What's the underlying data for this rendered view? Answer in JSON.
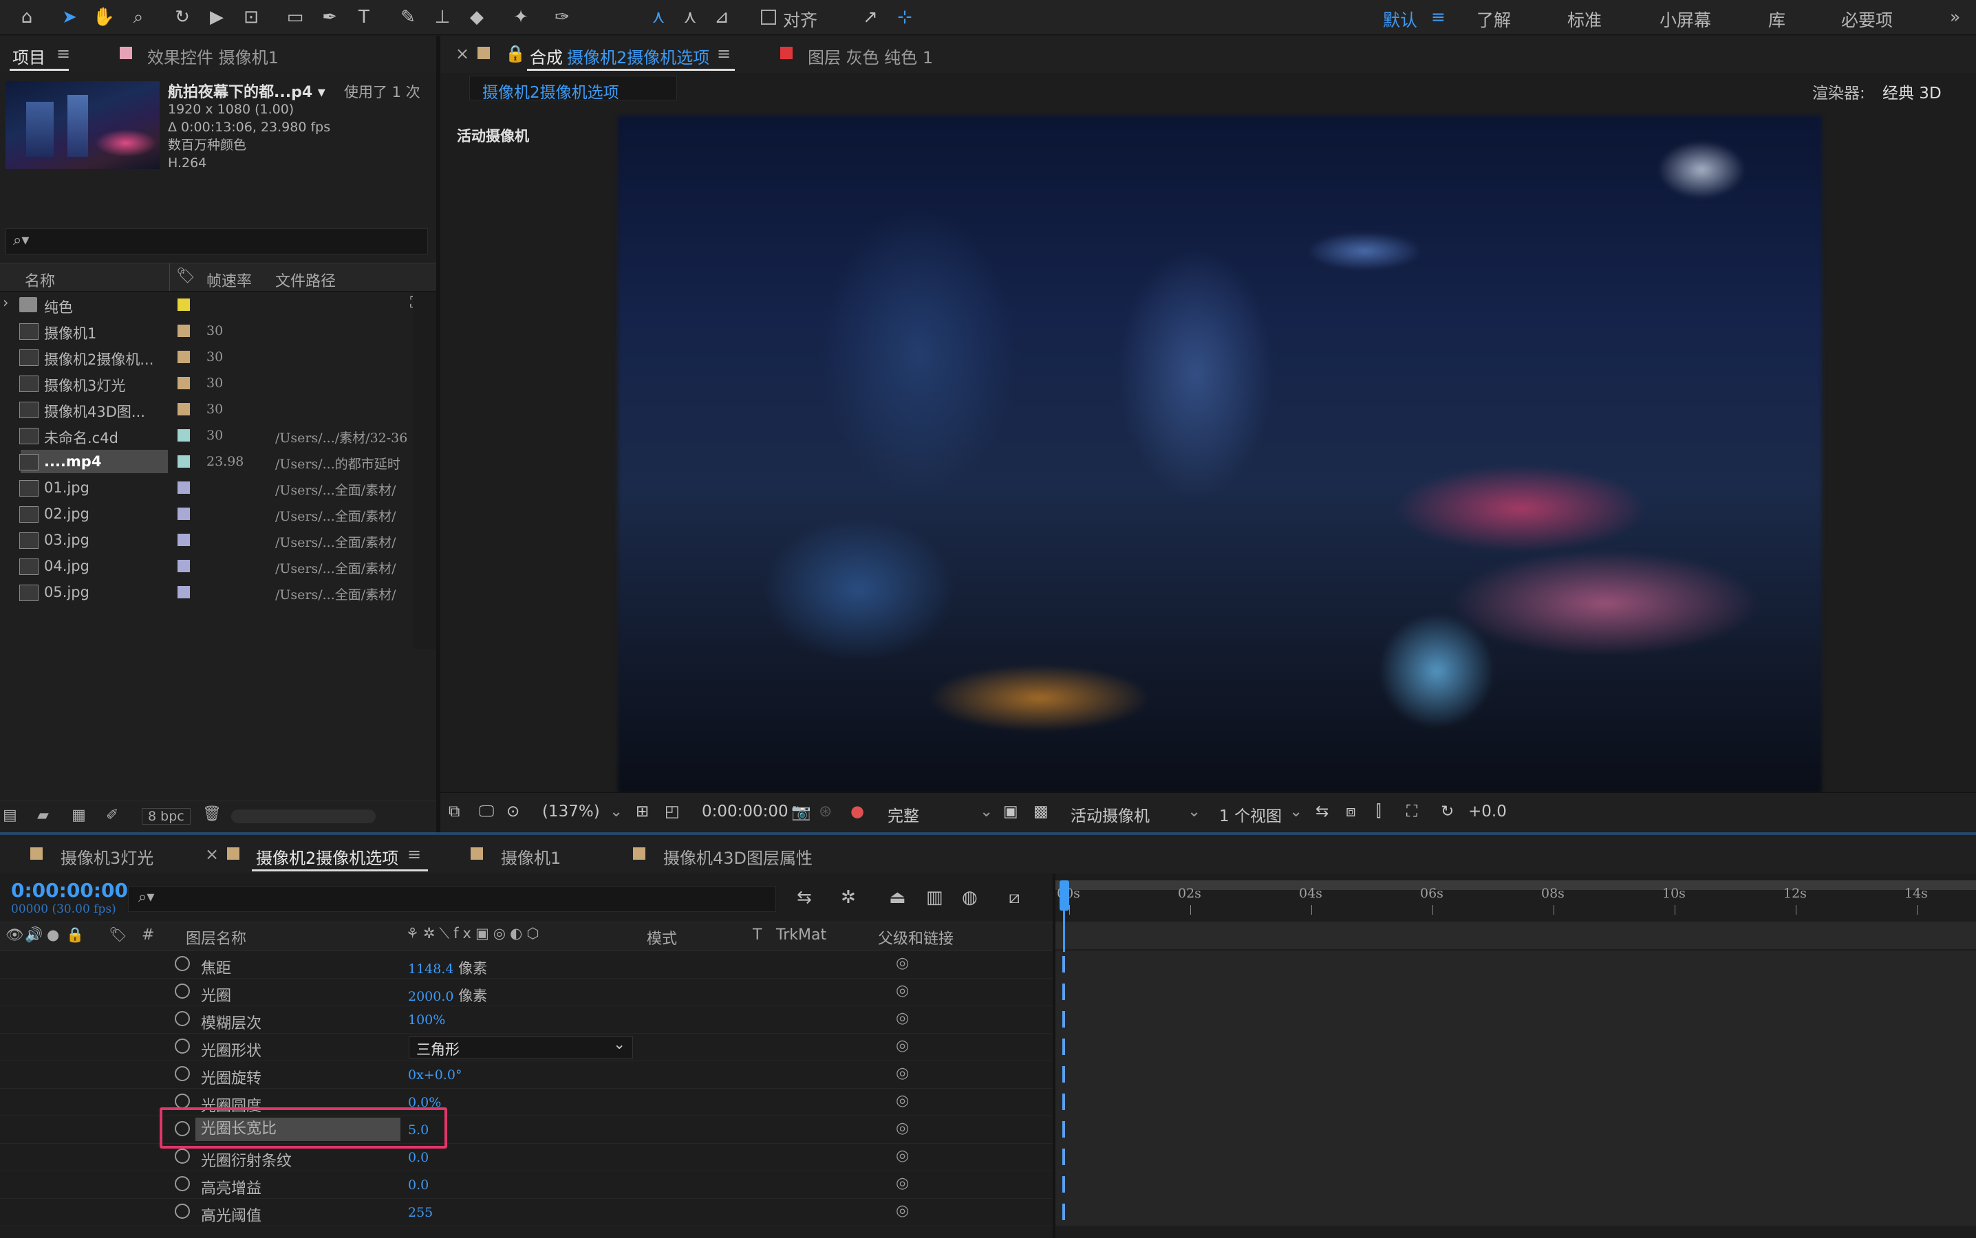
{
  "toolbar": {
    "align_label": "对齐",
    "workspaces": [
      "默认",
      "了解",
      "标准",
      "小屏幕",
      "库",
      "必要项"
    ],
    "more": "»"
  },
  "project_panel": {
    "tab_project": "项目",
    "tab_effects": "效果控件 摄像机1",
    "footage_name": "航拍夜幕下的都...p4 ▾",
    "used_count": "使用了 1 次",
    "footage_info": [
      "1920 x 1080 (1.00)",
      "Δ 0:00:13:06, 23.980 fps",
      "数百万种颜色",
      "H.264"
    ],
    "columns": {
      "name": "名称",
      "fps": "帧速率",
      "path": "文件路径"
    },
    "items": [
      {
        "name": "纯色",
        "fps": "",
        "path": "",
        "color": "#e6d43a"
      },
      {
        "name": "摄像机1",
        "fps": "30",
        "path": "",
        "color": "#c9a878"
      },
      {
        "name": "摄像机2摄像机...",
        "fps": "30",
        "path": "",
        "color": "#c9a878"
      },
      {
        "name": "摄像机3灯光",
        "fps": "30",
        "path": "",
        "color": "#c9a878"
      },
      {
        "name": "摄像机43D图...",
        "fps": "30",
        "path": "",
        "color": "#c9a878"
      },
      {
        "name": "未命名.c4d",
        "fps": "30",
        "path": "/Users/.../素材/32-36",
        "color": "#9fd3cf"
      },
      {
        "name": "....mp4",
        "fps": "23.98",
        "path": "/Users/...的都市延时",
        "color": "#9fd3cf"
      },
      {
        "name": "01.jpg",
        "fps": "",
        "path": "/Users/...全面/素材/",
        "color": "#a9a9d6"
      },
      {
        "name": "02.jpg",
        "fps": "",
        "path": "/Users/...全面/素材/",
        "color": "#a9a9d6"
      },
      {
        "name": "03.jpg",
        "fps": "",
        "path": "/Users/...全面/素材/",
        "color": "#a9a9d6"
      },
      {
        "name": "04.jpg",
        "fps": "",
        "path": "/Users/...全面/素材/",
        "color": "#a9a9d6"
      },
      {
        "name": "05.jpg",
        "fps": "",
        "path": "/Users/...全面/素材/",
        "color": "#a9a9d6"
      }
    ],
    "bpc": "8 bpc"
  },
  "viewer": {
    "tab_comp_prefix": "合成",
    "tab_comp_name": "摄像机2摄像机选项",
    "tab_layer": "图层 灰色 纯色 1",
    "subtab": "摄像机2摄像机选项",
    "renderer_label": "渲染器:",
    "renderer_value": "经典 3D",
    "active_camera": "活动摄像机",
    "zoom": "(137%)",
    "timecode": "0:00:00:00",
    "quality": "完整",
    "camera_select": "活动摄像机",
    "views": "1 个视图",
    "exposure": "+0.0"
  },
  "timeline": {
    "tabs": [
      "摄像机3灯光",
      "摄像机2摄像机选项",
      "摄像机1",
      "摄像机43D图层属性"
    ],
    "timecode": "0:00:00:00",
    "frame_info": "00000 (30.00 fps)",
    "columns": {
      "num": "#",
      "layer_name": "图层名称",
      "mode": "模式",
      "t": "T",
      "trkmat": "TrkMat",
      "parent": "父级和链接"
    },
    "ruler": [
      "00s",
      "02s",
      "04s",
      "06s",
      "08s",
      "10s",
      "12s",
      "14s"
    ],
    "properties": [
      {
        "name": "焦距",
        "value": "1148.4",
        "unit": "像素"
      },
      {
        "name": "光圈",
        "value": "2000.0",
        "unit": "像素"
      },
      {
        "name": "模糊层次",
        "value": "100%",
        "unit": ""
      },
      {
        "name": "光圈形状",
        "value": "三角形",
        "unit": ""
      },
      {
        "name": "光圈旋转",
        "value": "0x+0.0°",
        "unit": ""
      },
      {
        "name": "光圈圆度",
        "value": "0.0%",
        "unit": ""
      },
      {
        "name": "光圈长宽比",
        "value": "5.0",
        "unit": ""
      },
      {
        "name": "光圈衍射条纹",
        "value": "0.0",
        "unit": ""
      },
      {
        "name": "高亮增益",
        "value": "0.0",
        "unit": ""
      },
      {
        "name": "高光阈值",
        "value": "255",
        "unit": ""
      }
    ]
  },
  "colors": {
    "accent": "#3d9bf6",
    "highlight_box": "#e0366a"
  }
}
